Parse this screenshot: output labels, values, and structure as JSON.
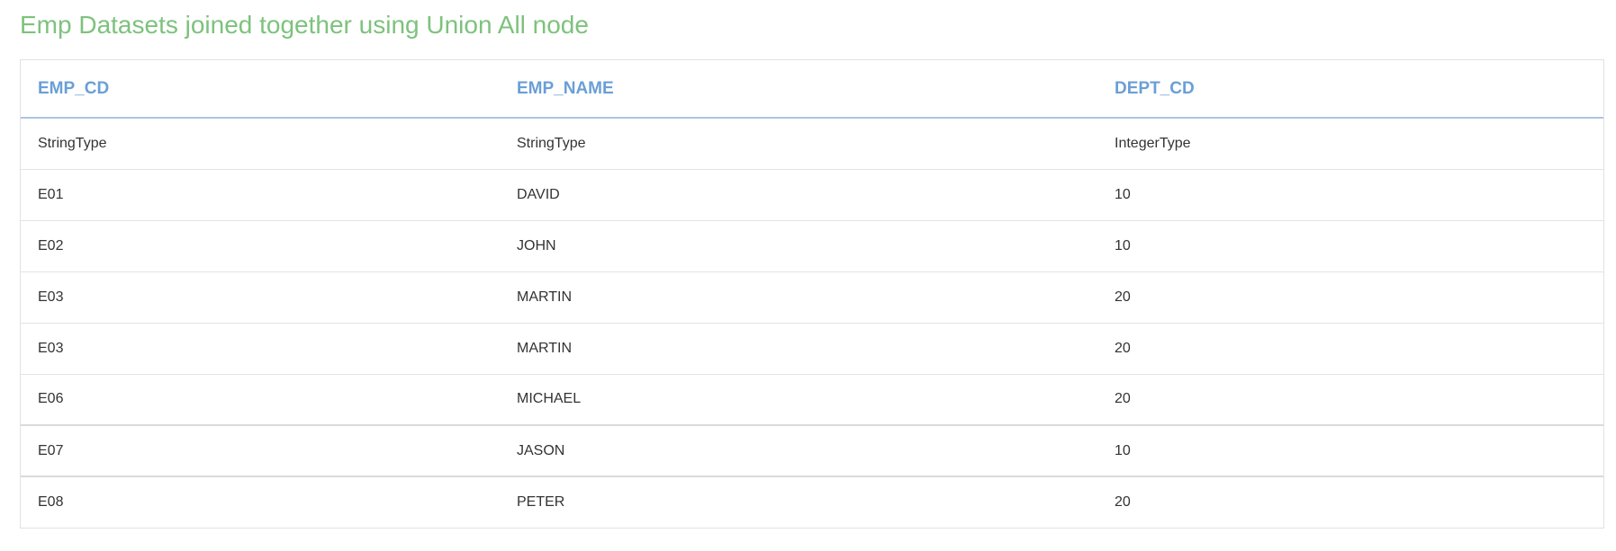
{
  "title": "Emp Datasets joined together using Union All node",
  "colors": {
    "title": "#7dc27d",
    "header": "#6a9fd6"
  },
  "table": {
    "columns": [
      "EMP_CD",
      "EMP_NAME",
      "DEPT_CD"
    ],
    "rows": [
      [
        "StringType",
        "StringType",
        "IntegerType"
      ],
      [
        "E01",
        "DAVID",
        "10"
      ],
      [
        "E02",
        "JOHN",
        "10"
      ],
      [
        "E03",
        "MARTIN",
        "20"
      ],
      [
        "E03",
        "MARTIN",
        "20"
      ],
      [
        "E06",
        "MICHAEL",
        "20"
      ],
      [
        "E07",
        "JASON",
        "10"
      ],
      [
        "E08",
        "PETER",
        "20"
      ]
    ]
  }
}
